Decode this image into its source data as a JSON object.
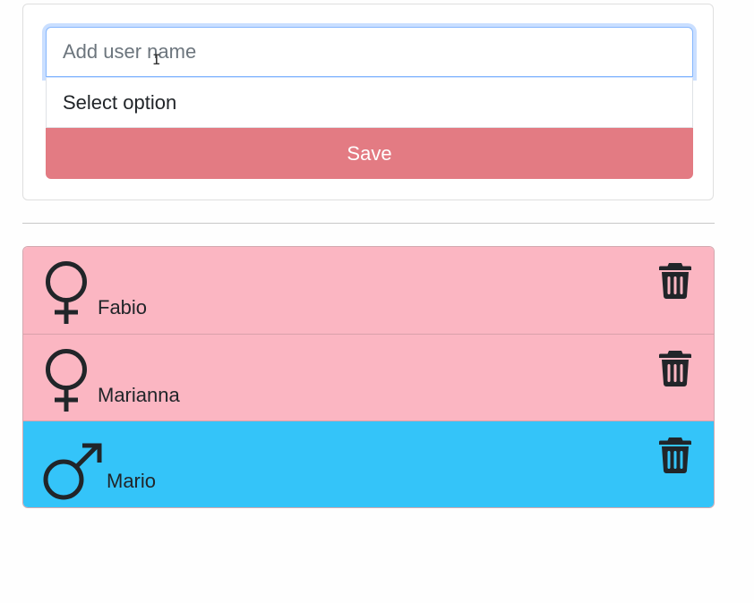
{
  "form": {
    "name_placeholder": "Add user name",
    "name_value": "",
    "select_value": "Select option",
    "save_label": "Save"
  },
  "users": [
    {
      "name": "Fabio",
      "gender": "female",
      "gender_icon": "female-symbol-icon",
      "row_color": "#fbb6c2"
    },
    {
      "name": "Marianna",
      "gender": "female",
      "gender_icon": "female-symbol-icon",
      "row_color": "#fbb6c2"
    },
    {
      "name": "Mario",
      "gender": "male",
      "gender_icon": "male-symbol-icon",
      "row_color": "#34c4f9"
    }
  ],
  "colors": {
    "save_button": "#e37b83",
    "female_row": "#fbb6c2",
    "male_row": "#34c4f9"
  },
  "icons": {
    "delete": "trash-icon",
    "cursor": "text-cursor-icon"
  }
}
